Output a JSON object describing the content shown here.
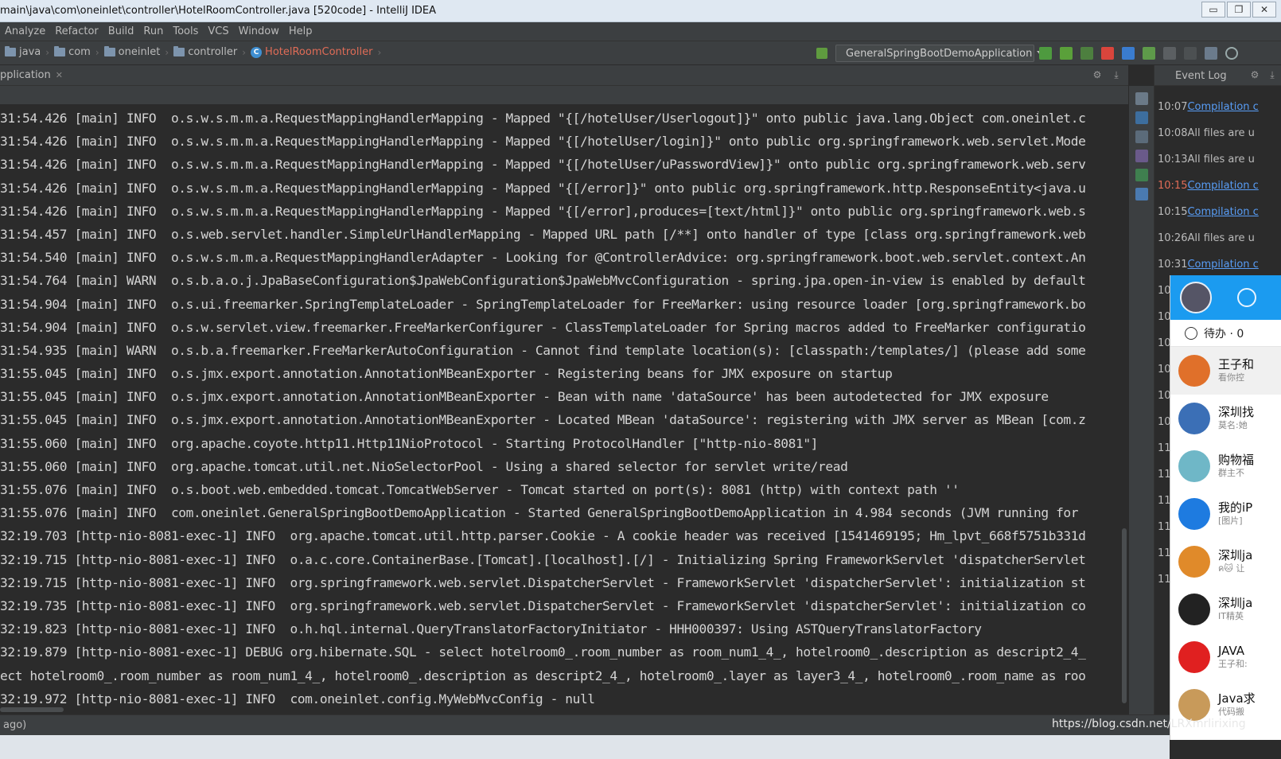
{
  "window": {
    "title": "main\\java\\com\\oneinlet\\controller\\HotelRoomController.java [520code] - IntelliJ IDEA",
    "buttons": [
      "▭",
      "❐",
      "✕"
    ]
  },
  "menu": [
    "Analyze",
    "Refactor",
    "Build",
    "Run",
    "Tools",
    "VCS",
    "Window",
    "Help"
  ],
  "breadcrumb": [
    {
      "label": "java"
    },
    {
      "label": "com"
    },
    {
      "label": "oneinlet"
    },
    {
      "label": "controller"
    },
    {
      "label": "HotelRoomController"
    }
  ],
  "run_config": {
    "label": "GeneralSpringBootDemoApplication"
  },
  "run_panel": {
    "tab_label": "pplication"
  },
  "console_lines": [
    "31:54.426 [main] INFO  o.s.w.s.m.m.a.RequestMappingHandlerMapping - Mapped \"{[/hotelUser/Userlogout]}\" onto public java.lang.Object com.oneinlet.c",
    "31:54.426 [main] INFO  o.s.w.s.m.m.a.RequestMappingHandlerMapping - Mapped \"{[/hotelUser/login]}\" onto public org.springframework.web.servlet.Mode",
    "31:54.426 [main] INFO  o.s.w.s.m.m.a.RequestMappingHandlerMapping - Mapped \"{[/hotelUser/uPasswordView]}\" onto public org.springframework.web.serv",
    "31:54.426 [main] INFO  o.s.w.s.m.m.a.RequestMappingHandlerMapping - Mapped \"{[/error]}\" onto public org.springframework.http.ResponseEntity<java.u",
    "31:54.426 [main] INFO  o.s.w.s.m.m.a.RequestMappingHandlerMapping - Mapped \"{[/error],produces=[text/html]}\" onto public org.springframework.web.s",
    "31:54.457 [main] INFO  o.s.web.servlet.handler.SimpleUrlHandlerMapping - Mapped URL path [/**] onto handler of type [class org.springframework.web",
    "31:54.540 [main] INFO  o.s.w.s.m.m.a.RequestMappingHandlerAdapter - Looking for @ControllerAdvice: org.springframework.boot.web.servlet.context.An",
    "31:54.764 [main] WARN  o.s.b.a.o.j.JpaBaseConfiguration$JpaWebConfiguration$JpaWebMvcConfiguration - spring.jpa.open-in-view is enabled by default",
    "31:54.904 [main] INFO  o.s.ui.freemarker.SpringTemplateLoader - SpringTemplateLoader for FreeMarker: using resource loader [org.springframework.bo",
    "31:54.904 [main] INFO  o.s.w.servlet.view.freemarker.FreeMarkerConfigurer - ClassTemplateLoader for Spring macros added to FreeMarker configuratio",
    "31:54.935 [main] WARN  o.s.b.a.freemarker.FreeMarkerAutoConfiguration - Cannot find template location(s): [classpath:/templates/] (please add some",
    "31:55.045 [main] INFO  o.s.jmx.export.annotation.AnnotationMBeanExporter - Registering beans for JMX exposure on startup",
    "31:55.045 [main] INFO  o.s.jmx.export.annotation.AnnotationMBeanExporter - Bean with name 'dataSource' has been autodetected for JMX exposure",
    "31:55.045 [main] INFO  o.s.jmx.export.annotation.AnnotationMBeanExporter - Located MBean 'dataSource': registering with JMX server as MBean [com.z",
    "31:55.060 [main] INFO  org.apache.coyote.http11.Http11NioProtocol - Starting ProtocolHandler [\"http-nio-8081\"]",
    "31:55.060 [main] INFO  org.apache.tomcat.util.net.NioSelectorPool - Using a shared selector for servlet write/read",
    "31:55.076 [main] INFO  o.s.boot.web.embedded.tomcat.TomcatWebServer - Tomcat started on port(s): 8081 (http) with context path ''",
    "31:55.076 [main] INFO  com.oneinlet.GeneralSpringBootDemoApplication - Started GeneralSpringBootDemoApplication in 4.984 seconds (JVM running for",
    "32:19.703 [http-nio-8081-exec-1] INFO  org.apache.tomcat.util.http.parser.Cookie - A cookie header was received [1541469195; Hm_lpvt_668f5751b331d",
    "32:19.715 [http-nio-8081-exec-1] INFO  o.a.c.core.ContainerBase.[Tomcat].[localhost].[/] - Initializing Spring FrameworkServlet 'dispatcherServlet",
    "32:19.715 [http-nio-8081-exec-1] INFO  org.springframework.web.servlet.DispatcherServlet - FrameworkServlet 'dispatcherServlet': initialization st",
    "32:19.735 [http-nio-8081-exec-1] INFO  org.springframework.web.servlet.DispatcherServlet - FrameworkServlet 'dispatcherServlet': initialization co",
    "32:19.823 [http-nio-8081-exec-1] INFO  o.h.hql.internal.QueryTranslatorFactoryInitiator - HHH000397: Using ASTQueryTranslatorFactory",
    "32:19.879 [http-nio-8081-exec-1] DEBUG org.hibernate.SQL - select hotelroom0_.room_number as room_num1_4_, hotelroom0_.description as descript2_4_",
    "ect hotelroom0_.room_number as room_num1_4_, hotelroom0_.description as descript2_4_, hotelroom0_.layer as layer3_4_, hotelroom0_.room_name as roo",
    "32:19.972 [http-nio-8081-exec-1] INFO  com.oneinlet.config.MyWebMvcConfig - null"
  ],
  "event_log": {
    "title": "Event Log",
    "entries": [
      {
        "time": "10:07",
        "text": "Compilation c",
        "kind": "link",
        "time_color": "normal"
      },
      {
        "time": "10:08",
        "text": "All files are u",
        "kind": "text",
        "time_color": "normal"
      },
      {
        "time": "10:13",
        "text": "All files are u",
        "kind": "text",
        "time_color": "normal"
      },
      {
        "time": "10:15",
        "text": "Compilation c",
        "kind": "link",
        "time_color": "red"
      },
      {
        "time": "10:15",
        "text": "Compilation c",
        "kind": "link",
        "time_color": "normal"
      },
      {
        "time": "10:26",
        "text": "All files are u",
        "kind": "text",
        "time_color": "normal"
      },
      {
        "time": "10:31",
        "text": "Compilation c",
        "kind": "link",
        "time_color": "normal"
      }
    ],
    "hidden_times": [
      "10",
      "10",
      "10",
      "10",
      "10",
      "10",
      "11",
      "11",
      "11",
      "11",
      "11",
      "11"
    ]
  },
  "chat_panel": {
    "todo_label": "待办 · 0",
    "items": [
      {
        "name": "王子和",
        "sub": "看你控",
        "color": "#e0702a"
      },
      {
        "name": "深圳找",
        "sub": "莫名:她",
        "color": "#3b6fb6"
      },
      {
        "name": "购物福",
        "sub": "群主不",
        "color": "#6fb7c7"
      },
      {
        "name": "我的iP",
        "sub": "[图片]",
        "color": "#1e7be0"
      },
      {
        "name": "深圳ja",
        "sub": "ค🐱 让",
        "color": "#e08a2a"
      },
      {
        "name": "深圳ja",
        "sub": "IT精英",
        "color": "#222222"
      },
      {
        "name": "JAVA",
        "sub": "王子和:",
        "color": "#e02020"
      },
      {
        "name": "Java求",
        "sub": "代码搬",
        "color": "#c89a5a"
      }
    ]
  },
  "status": {
    "message": "ago)"
  },
  "watermark": "https://blog.csdn.net/LRXmrlirixing",
  "colors": {
    "console_bg": "#2b2b2b",
    "panel_bg": "#3c3f41",
    "link": "#589df6",
    "error_red": "#e06c57"
  }
}
